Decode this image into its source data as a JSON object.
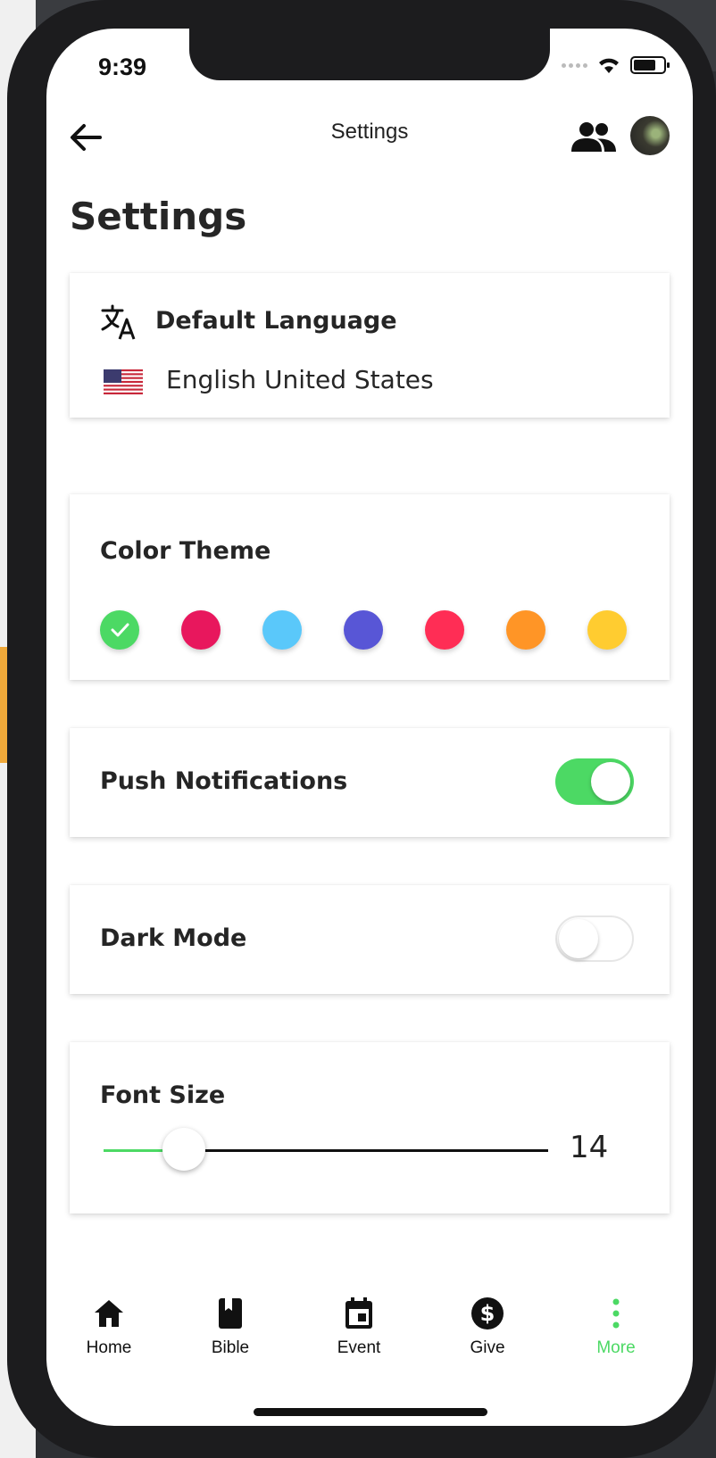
{
  "status_bar": {
    "time": "9:39"
  },
  "header": {
    "title": "Settings"
  },
  "page": {
    "title": "Settings"
  },
  "language": {
    "label": "Default Language",
    "value": "English United States"
  },
  "theme": {
    "label": "Color Theme",
    "swatches": [
      "#4cd964",
      "#e8175d",
      "#5ac8fa",
      "#5856d6",
      "#ff2d55",
      "#ff9526",
      "#ffcc30"
    ],
    "selected_index": 0
  },
  "push": {
    "label": "Push Notifications",
    "enabled": true
  },
  "dark_mode": {
    "label": "Dark Mode",
    "enabled": false
  },
  "font_size": {
    "label": "Font Size",
    "value": "14",
    "slider_fraction": 0.18
  },
  "tabs": [
    {
      "label": "Home",
      "icon": "home-icon"
    },
    {
      "label": "Bible",
      "icon": "book-icon"
    },
    {
      "label": "Event",
      "icon": "calendar-icon"
    },
    {
      "label": "Give",
      "icon": "dollar-icon"
    },
    {
      "label": "More",
      "icon": "more-vertical-icon",
      "active": true
    }
  ],
  "colors": {
    "accent": "#4cd964",
    "text": "#252525"
  }
}
